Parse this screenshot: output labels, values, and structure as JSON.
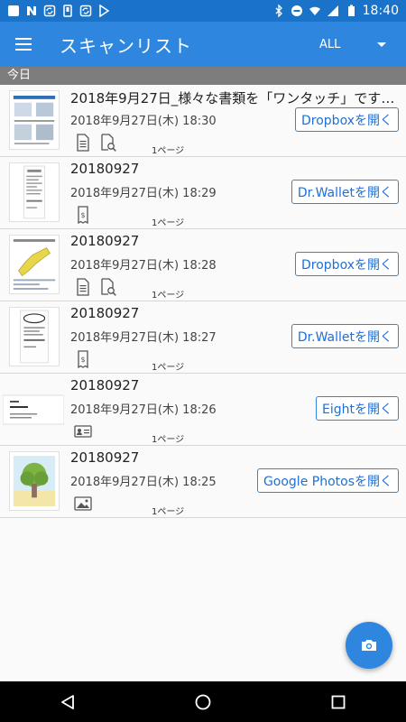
{
  "status_bar": {
    "time": "18:40"
  },
  "app_bar": {
    "title": "スキャンリスト",
    "filter": "ALL"
  },
  "section_header": "今日",
  "items": [
    {
      "title": "2018年9月27日_様々な書類を「ワンタッチ」ですばや…",
      "date": "2018年9月27日(木) 18:30",
      "pages": "1ページ",
      "button": "Dropboxを開く",
      "icons": [
        "document-icon",
        "ocr-search-icon"
      ]
    },
    {
      "title": "20180927",
      "date": "2018年9月27日(木) 18:29",
      "pages": "1ページ",
      "button": "Dr.Walletを開く",
      "icons": [
        "receipt-icon"
      ]
    },
    {
      "title": "20180927",
      "date": "2018年9月27日(木) 18:28",
      "pages": "1ページ",
      "button": "Dropboxを開く",
      "icons": [
        "document-icon",
        "ocr-search-icon"
      ]
    },
    {
      "title": "20180927",
      "date": "2018年9月27日(木) 18:27",
      "pages": "1ページ",
      "button": "Dr.Walletを開く",
      "icons": [
        "receipt-icon"
      ]
    },
    {
      "title": "20180927",
      "date": "2018年9月27日(木) 18:26",
      "pages": "1ページ",
      "button": "Eightを開く",
      "icons": [
        "business-card-icon"
      ]
    },
    {
      "title": "20180927",
      "date": "2018年9月27日(木) 18:25",
      "pages": "1ページ",
      "button": "Google Photosを開く",
      "icons": [
        "photo-icon"
      ]
    }
  ],
  "colors": {
    "primary": "#2f86de",
    "status_bar": "#1b73c9",
    "section": "#7d7d7d",
    "button_text": "#1f6fd1"
  }
}
